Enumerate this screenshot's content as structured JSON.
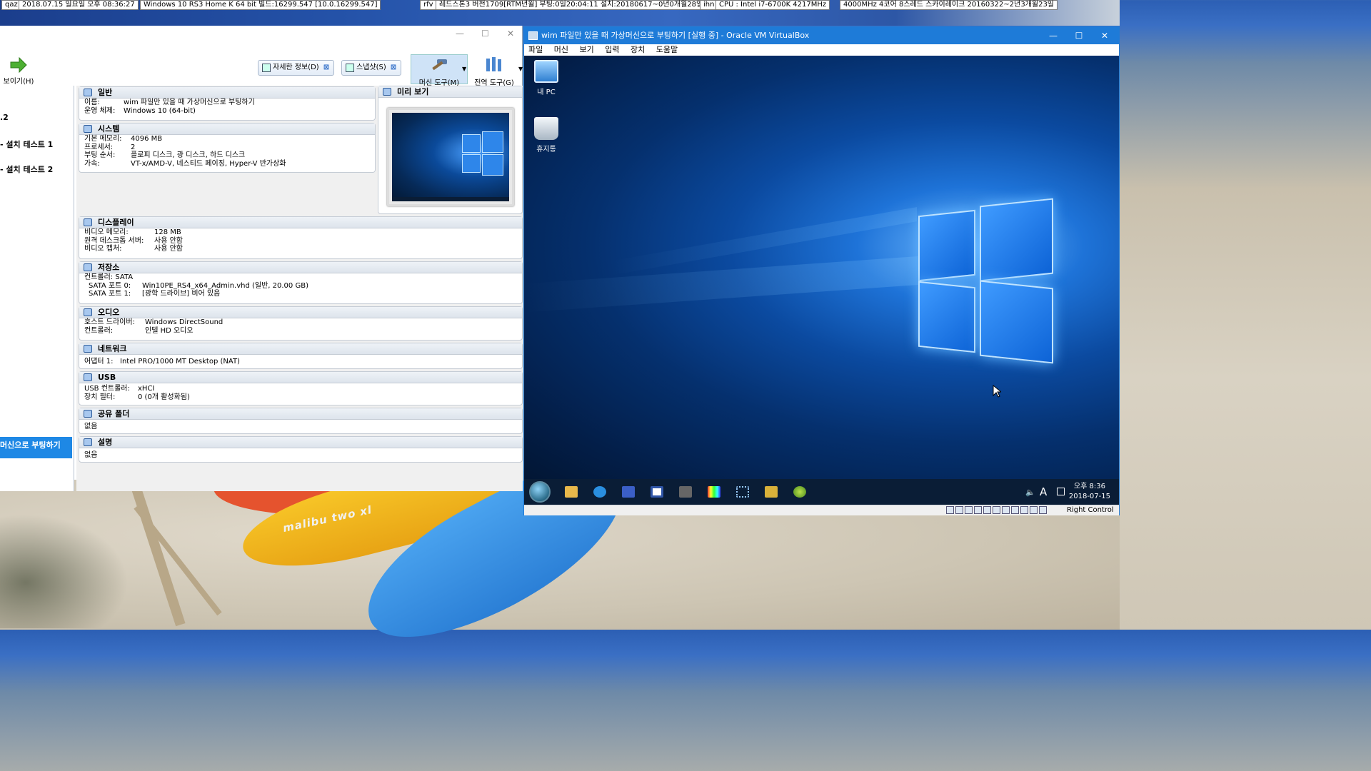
{
  "statusbar": {
    "s1": "qaz",
    "s2": "2018.07.15 일요일 오후 08:36:27",
    "s3": "Windows 10 RS3 Home K 64 bit 빌드:16299.547 [10.0.16299.547]",
    "s4": "rfv",
    "s5": "레드스톤3 버전1709[RTM년월] 부팅:0일20:04:11 설치:20180617~0년0개월28일",
    "s6": "ihn",
    "s7": "CPU : Intel i7-6700K 4217MHz",
    "s8": "4000MHz 4코어 8스레드 스카이레이크 20160322~2년3개월23일"
  },
  "wallpaper": {
    "kayak_text": "malibu two xl"
  },
  "manager": {
    "window_controls": {
      "min": "—",
      "max": "☐",
      "close": "✕"
    },
    "show_label": "보이기(H)",
    "details_btn": "자세한 정보(D)",
    "snapshot_btn": "스냅샷(S)",
    "machine_tools": "머신 도구(M)",
    "global_tools": "전역 도구(G)",
    "sidebar": {
      "item1": ".2",
      "item2": "- 설치 테스트 1",
      "item3": "- 설치 테스트 2",
      "selected": "머신으로 부팅하기"
    },
    "sections": {
      "general": {
        "title": "일반",
        "rows": [
          [
            "이름:",
            "wim 파일만 있을 때 가상머신으로 부팅하기"
          ],
          [
            "운영 체제:",
            "Windows 10 (64-bit)"
          ]
        ]
      },
      "system": {
        "title": "시스템",
        "rows": [
          [
            "기본 메모리:",
            "4096 MB"
          ],
          [
            "프로세서:",
            "2"
          ],
          [
            "부팅 순서:",
            "플로피 디스크, 광 디스크, 하드 디스크"
          ],
          [
            "가속:",
            "VT-x/AMD-V, 네스티드 페이징, Hyper-V 반가상화"
          ]
        ]
      },
      "preview": {
        "title": "미리 보기"
      },
      "display": {
        "title": "디스플레이",
        "rows": [
          [
            "비디오 메모리:",
            "128 MB"
          ],
          [
            "원격 데스크톱 서버:",
            "사용 안함"
          ],
          [
            "비디오 캡처:",
            "사용 안함"
          ]
        ]
      },
      "storage": {
        "title": "저장소",
        "rows": [
          [
            "컨트롤러: SATA",
            ""
          ],
          [
            "  SATA 포트 0:",
            "Win10PE_RS4_x64_Admin.vhd (일반, 20.00 GB)"
          ],
          [
            "  SATA 포트 1:",
            "[광학 드라이브] 비어 있음"
          ]
        ]
      },
      "audio": {
        "title": "오디오",
        "rows": [
          [
            "호스트 드라이버:",
            "Windows DirectSound"
          ],
          [
            "컨트롤러:",
            "인텔 HD 오디오"
          ]
        ]
      },
      "network": {
        "title": "네트워크",
        "rows": [
          [
            "어댑터 1:",
            "Intel PRO/1000 MT Desktop (NAT)"
          ]
        ]
      },
      "usb": {
        "title": "USB",
        "rows": [
          [
            "USB 컨트롤러:",
            "xHCI"
          ],
          [
            "장치 필터:",
            "0 (0개 활성화됨)"
          ]
        ]
      },
      "shared": {
        "title": "공유 폴더",
        "rows": [
          [
            "없음",
            ""
          ]
        ]
      },
      "description": {
        "title": "설명",
        "rows": [
          [
            "없음",
            ""
          ]
        ]
      }
    }
  },
  "vm": {
    "title": "wim 파일만 있을 때 가상머신으로 부팅하기 [실행 중] - Oracle VM VirtualBox",
    "controls": {
      "min": "—",
      "max": "☐",
      "close": "✕"
    },
    "menu": [
      "파일",
      "머신",
      "보기",
      "입력",
      "장치",
      "도움말"
    ],
    "desktop_icons": [
      "내 PC",
      "휴지통"
    ],
    "clock_time": "오후 8:36",
    "clock_date": "2018-07-15",
    "tray_ime": "A",
    "host_key": "Right Control"
  }
}
